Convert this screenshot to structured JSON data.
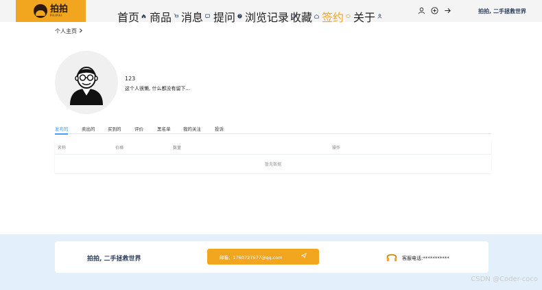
{
  "header": {
    "logo_text": "拍拍",
    "logo_sub": "PAIPAI",
    "nav": [
      {
        "label": "首页",
        "icon": "home-icon"
      },
      {
        "label": "商品",
        "icon": "cart-icon"
      },
      {
        "label": "消息",
        "icon": "message-icon"
      },
      {
        "label": "提问",
        "icon": "question-icon"
      },
      {
        "label": "浏览记录",
        "icon": "history-icon"
      },
      {
        "label": "收藏",
        "icon": "favorite-icon"
      },
      {
        "label": "签约",
        "icon": "link-icon",
        "active": true
      },
      {
        "label": "关于",
        "icon": "user-icon"
      }
    ],
    "slogan": "拍拍, 二手拯救世界"
  },
  "breadcrumb": {
    "label": "个人主页"
  },
  "profile": {
    "username": "123",
    "bio": "这个人很懒, 什么都没有留下..."
  },
  "tabs": [
    "发布的",
    "卖出的",
    "买到的",
    "评价",
    "黑名单",
    "我的关注",
    "投诉"
  ],
  "table": {
    "columns": [
      "名称",
      "价格",
      "数量",
      "操作"
    ],
    "empty_text": "暂无数据"
  },
  "footer": {
    "slogan": "拍拍, 二手拯救世界",
    "email": "邮箱：1760727677@qq.com",
    "phone": "客服电话:***********"
  },
  "watermark": "CSDN @Coder-coco",
  "colors": {
    "brand": "#f2a51f",
    "nav_text": "#2d3e5b",
    "tab_active": "#409eff",
    "footer_bg": "#e3effa"
  }
}
